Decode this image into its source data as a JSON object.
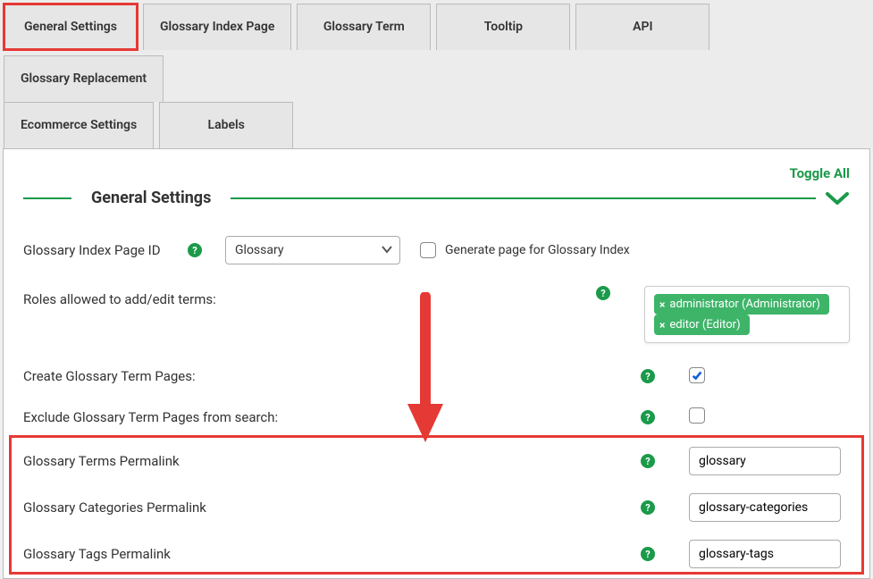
{
  "tabs_row1": [
    {
      "label": "General Settings",
      "highlight": true
    },
    {
      "label": "Glossary Index Page"
    },
    {
      "label": "Glossary Term"
    },
    {
      "label": "Tooltip"
    },
    {
      "label": "API"
    },
    {
      "label": "Glossary Replacement"
    }
  ],
  "tabs_row2": [
    {
      "label": "Ecommerce Settings"
    },
    {
      "label": "Labels"
    }
  ],
  "toggle_all": "Toggle All",
  "section_title": "General Settings",
  "rows": {
    "index_page": {
      "label": "Glossary Index Page ID",
      "select_value": "Glossary",
      "checkbox_label": "Generate page for Glossary Index"
    },
    "roles": {
      "label": "Roles allowed to add/edit terms:",
      "tags": [
        "administrator (Administrator)",
        "editor (Editor)"
      ]
    },
    "create_pages": {
      "label": "Create Glossary Term Pages:",
      "checked": true
    },
    "exclude_search": {
      "label": "Exclude Glossary Term Pages from search:",
      "checked": false
    },
    "terms_permalink": {
      "label": "Glossary Terms Permalink",
      "value": "glossary"
    },
    "categories_permalink": {
      "label": "Glossary Categories Permalink",
      "value": "glossary-categories"
    },
    "tags_permalink": {
      "label": "Glossary Tags Permalink",
      "value": "glossary-tags"
    }
  },
  "help_glyph": "?"
}
